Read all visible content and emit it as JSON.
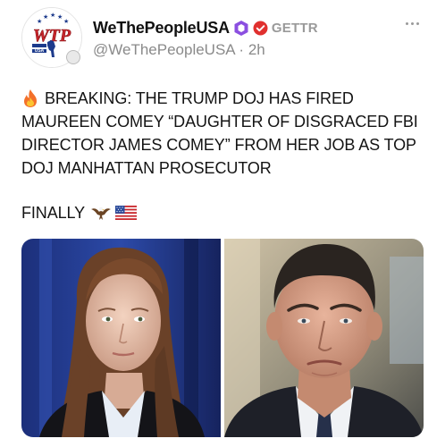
{
  "post": {
    "display_name": "WeThePeopleUSA",
    "platform": "GETTR",
    "handle": "@WeThePeopleUSA",
    "separator": " · ",
    "time_ago": "2h",
    "lines": [
      "BREAKING: THE TRUMP DOJ HAS FIRED",
      "MAUREEN COMEY “DAUGHTER OF DISGRACED FBI",
      "DIRECTOR JAMES COMEY” FROM HER JOB AS TOP",
      "DOJ MANHATTAN PROSECUTOR"
    ],
    "closing": "FINALLY",
    "avatar": {
      "logo_text": "WTP",
      "sub_text": "USA"
    },
    "icons": {
      "lead_emoji": "fire-icon",
      "closing_emojis": [
        "eagle-icon",
        "us-flag-icon"
      ],
      "badges": [
        "hexagon-badge-icon",
        "gettr-verified-icon"
      ],
      "menu": "more-options-icon"
    },
    "colors": {
      "badge_purple": "#8b4fe0",
      "gettr_red": "#e0302e",
      "text": "#141414",
      "muted": "#8a8a8a"
    },
    "media": {
      "count": 2,
      "alt_left": "",
      "alt_right": ""
    }
  }
}
